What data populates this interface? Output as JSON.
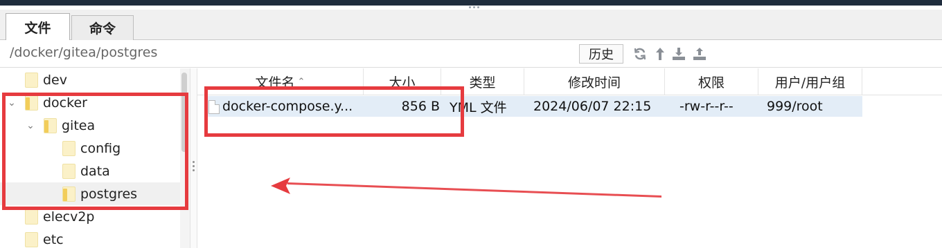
{
  "tabs": [
    {
      "label": "文件",
      "active": true
    },
    {
      "label": "命令",
      "active": false
    }
  ],
  "path": {
    "value": "/docker/gitea/postgres"
  },
  "toolbar": {
    "history_label": "历史",
    "icons": [
      "refresh-icon",
      "up-arrow-icon",
      "download-icon",
      "upload-icon"
    ]
  },
  "tree": [
    {
      "label": "dev",
      "expanded": null,
      "selected": false,
      "depth": 0
    },
    {
      "label": "docker",
      "expanded": true,
      "selected": false,
      "depth": 0
    },
    {
      "label": "gitea",
      "expanded": true,
      "selected": false,
      "depth": 1
    },
    {
      "label": "config",
      "expanded": null,
      "selected": false,
      "depth": 2
    },
    {
      "label": "data",
      "expanded": null,
      "selected": false,
      "depth": 2
    },
    {
      "label": "postgres",
      "expanded": null,
      "selected": true,
      "depth": 2
    },
    {
      "label": "elecv2p",
      "expanded": null,
      "selected": false,
      "depth": 0
    },
    {
      "label": "etc",
      "expanded": null,
      "selected": false,
      "depth": 0
    }
  ],
  "columns": {
    "name": "文件名",
    "size": "大小",
    "type": "类型",
    "mtime": "修改时间",
    "perm": "权限",
    "owner": "用户/用户组"
  },
  "files": [
    {
      "name": "docker-compose.y...",
      "size": "856 B",
      "type": "YML 文件",
      "mtime": "2024/06/07 22:15",
      "perm": "-rw-r--r--",
      "owner": "999/root"
    }
  ],
  "colors": {
    "annotation": "#e63b3f",
    "selection": "#e3edf7",
    "folder": "#f2cd5a"
  }
}
